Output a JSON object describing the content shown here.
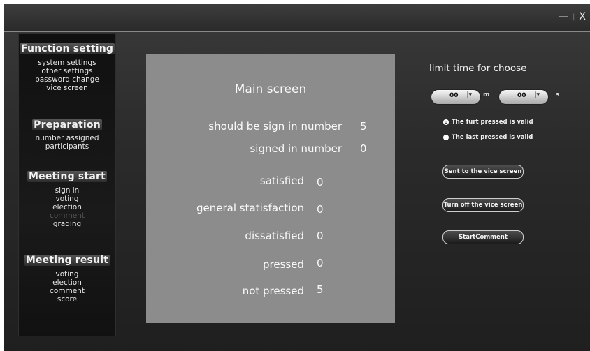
{
  "window": {
    "minimize": "—",
    "separator": "|",
    "close": "X"
  },
  "sidebar": {
    "function_setting": {
      "title": "Function setting",
      "items": [
        "system settings",
        "other settings",
        "password change",
        "vice screen"
      ]
    },
    "preparation": {
      "title": "Preparation",
      "items": [
        "number assigned",
        "participants"
      ]
    },
    "meeting_start": {
      "title": "Meeting start",
      "items": [
        "sign in",
        "voting",
        "election",
        "comment",
        "grading"
      ]
    },
    "meeting_result": {
      "title": "Meeting result",
      "items": [
        "voting",
        "election",
        "comment",
        "score"
      ]
    }
  },
  "main": {
    "title": "Main screen",
    "rows": [
      {
        "label": "should be sign in number",
        "value": "5"
      },
      {
        "label": "signed in number",
        "value": "0"
      },
      {
        "label": "satisfied",
        "value": "0"
      },
      {
        "label": "general statisfaction",
        "value": "0"
      },
      {
        "label": "dissatisfied",
        "value": "0"
      },
      {
        "label": "pressed",
        "value": "0"
      },
      {
        "label": "not pressed",
        "value": "5"
      }
    ]
  },
  "right": {
    "limit_title": "limit time for choose",
    "minutes": "00",
    "minutes_unit": "m",
    "seconds": "00",
    "seconds_unit": "s",
    "radio_first": "The furt pressed is valid",
    "radio_last": "The last pressed is valid",
    "btn_send": "Sent to the vice screen",
    "btn_off": "Turn off the vice screen",
    "btn_comment": "StartComment"
  }
}
